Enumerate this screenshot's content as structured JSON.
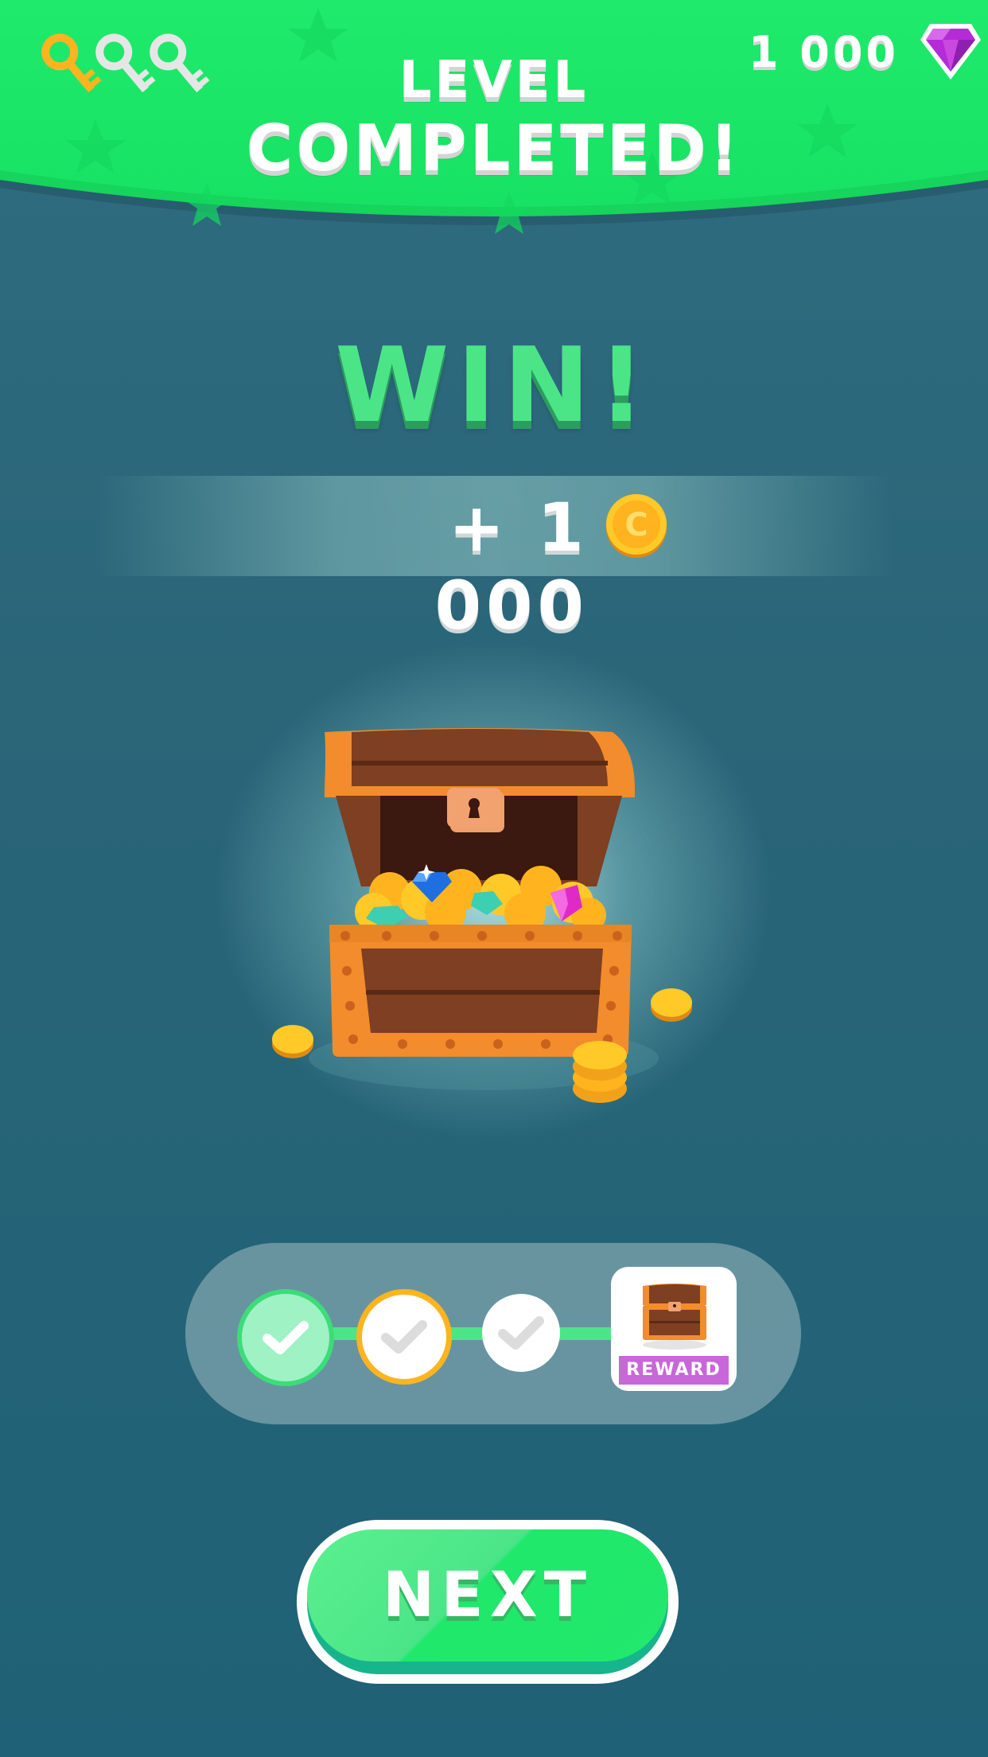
{
  "header": {
    "title_line1": "LEVEL",
    "title_line2": "COMPLETED!",
    "gem_count": "1 000",
    "keys_collected": 1,
    "keys_total": 3
  },
  "result": {
    "headline": "WIN!",
    "reward_amount": "+ 1 000"
  },
  "progress": {
    "steps_completed": 3,
    "reward_label": "REWARD"
  },
  "actions": {
    "next_label": "NEXT"
  },
  "colors": {
    "header_green": "#1fe86a",
    "accent_green": "#4be588",
    "background": "#2a6578",
    "gold": "#ffb41f",
    "reward_purple": "#c867d8",
    "gem_purple": "#b52bd8"
  },
  "icons": {
    "keys": "key-icon",
    "gem": "gem-icon",
    "coin": "coin-icon",
    "chest": "treasure-chest-icon",
    "step": "check-icon"
  }
}
